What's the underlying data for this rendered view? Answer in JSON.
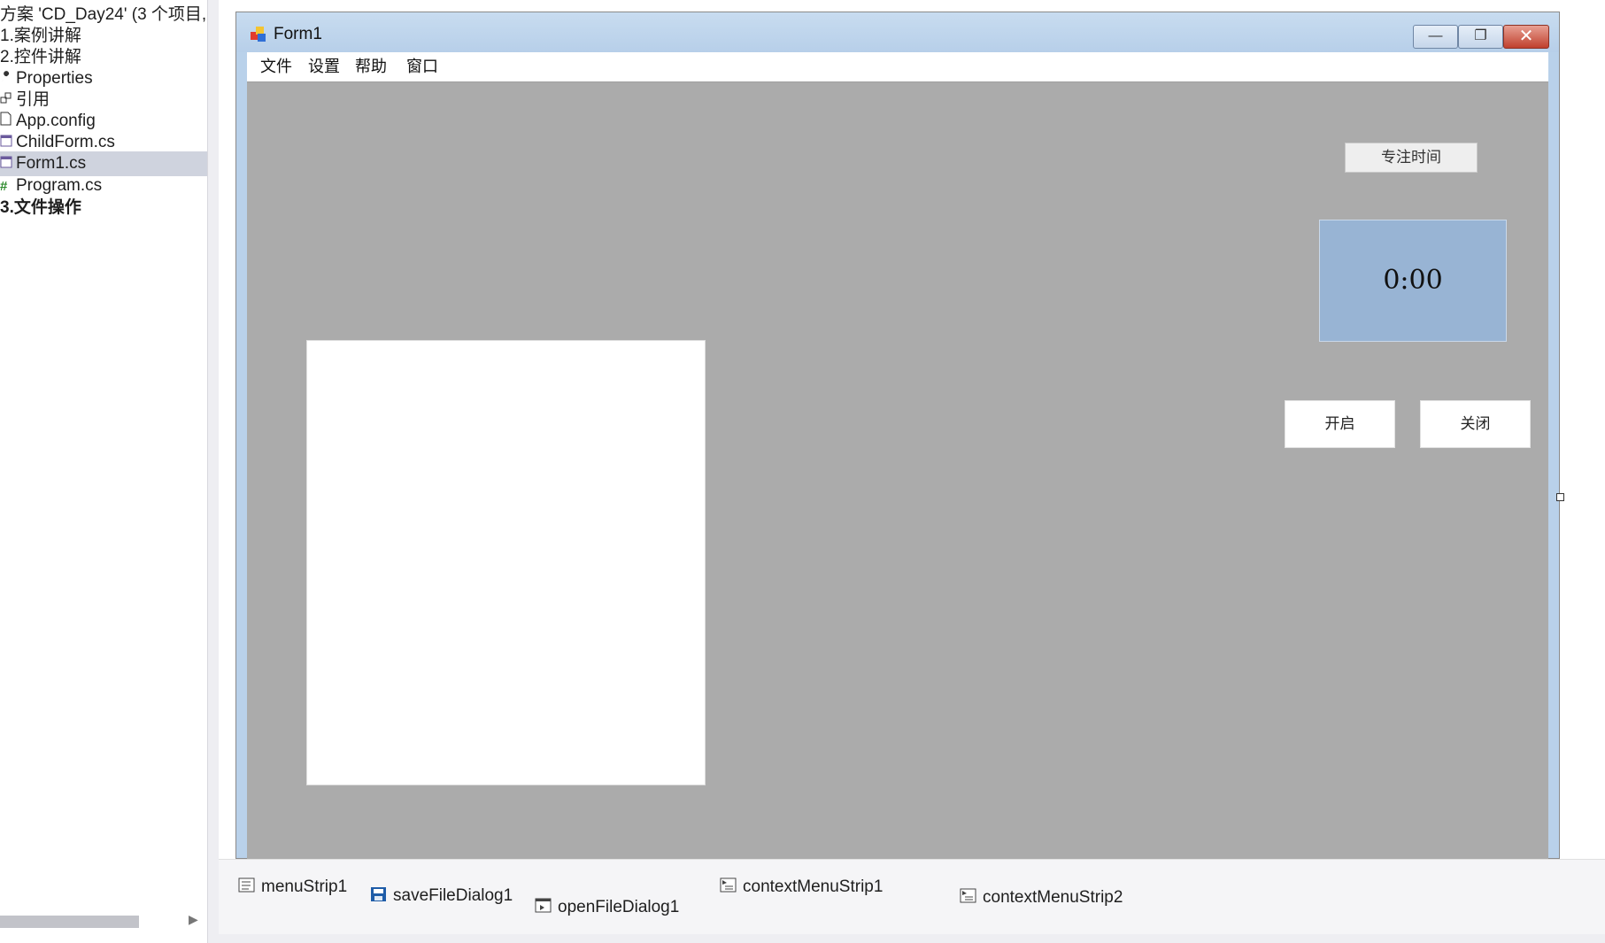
{
  "solution_explorer": {
    "items": [
      {
        "label": "方案 'CD_Day24' (3 个项目,",
        "icon": ""
      },
      {
        "label": "1.案例讲解",
        "icon": ""
      },
      {
        "label": "2.控件讲解",
        "icon": ""
      },
      {
        "label": "Properties",
        "icon": "wrench-icon"
      },
      {
        "label": "引用",
        "icon": "references-icon"
      },
      {
        "label": "App.config",
        "icon": "file-icon"
      },
      {
        "label": "ChildForm.cs",
        "icon": "form-file-icon"
      },
      {
        "label": "Form1.cs",
        "icon": "form-file-icon"
      },
      {
        "label": "Program.cs",
        "icon": "csharp-file-icon"
      },
      {
        "label": "3.文件操作",
        "icon": ""
      }
    ]
  },
  "form": {
    "title": "Form1",
    "window_buttons": {
      "minimize": "—",
      "maximize": "❐",
      "close": "✕"
    },
    "menu": [
      "文件",
      "设置",
      "帮助",
      "窗口"
    ],
    "focus_button_label": "专注时间",
    "timer_text": "0:00",
    "start_button_label": "开启",
    "close_button_label": "关闭",
    "client_color": "#ababab",
    "timer_color": "#98b4d4"
  },
  "component_tray": {
    "items": [
      {
        "label": "menuStrip1",
        "icon": "menustrip-icon"
      },
      {
        "label": "saveFileDialog1",
        "icon": "savefiledialog-icon"
      },
      {
        "label": "openFileDialog1",
        "icon": "openfiledialog-icon"
      },
      {
        "label": "contextMenuStrip1",
        "icon": "contextmenu-icon"
      },
      {
        "label": "contextMenuStrip2",
        "icon": "contextmenu-icon"
      }
    ]
  }
}
